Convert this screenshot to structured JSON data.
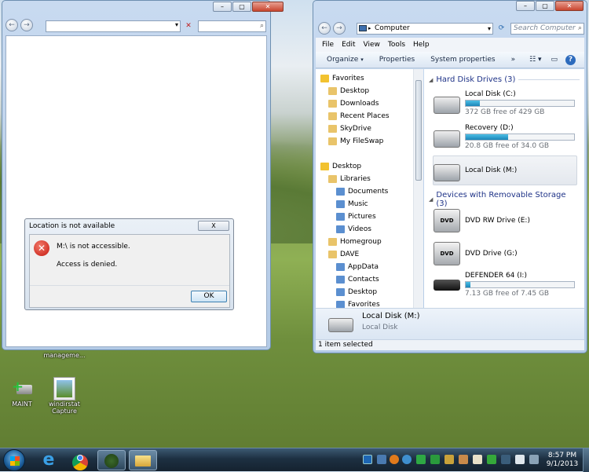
{
  "left_window": {
    "address": "",
    "search": ""
  },
  "dialog": {
    "title": "Location is not available",
    "close": "X",
    "message1": "M:\\ is not accessible.",
    "message2": "Access is denied.",
    "ok": "OK"
  },
  "explorer": {
    "breadcrumb": "Computer",
    "search_placeholder": "Search Computer",
    "menu": [
      "File",
      "Edit",
      "View",
      "Tools",
      "Help"
    ],
    "commands": [
      "Organize",
      "Properties",
      "System properties"
    ],
    "nav": [
      {
        "label": "Favorites",
        "indent": 0
      },
      {
        "label": "Desktop",
        "indent": 1
      },
      {
        "label": "Downloads",
        "indent": 1
      },
      {
        "label": "Recent Places",
        "indent": 1
      },
      {
        "label": "SkyDrive",
        "indent": 1
      },
      {
        "label": "My FileSwap",
        "indent": 1
      },
      {
        "label": "",
        "indent": 0
      },
      {
        "label": "Desktop",
        "indent": 0
      },
      {
        "label": "Libraries",
        "indent": 1
      },
      {
        "label": "Documents",
        "indent": 2
      },
      {
        "label": "Music",
        "indent": 2
      },
      {
        "label": "Pictures",
        "indent": 2
      },
      {
        "label": "Videos",
        "indent": 2
      },
      {
        "label": "Homegroup",
        "indent": 1
      },
      {
        "label": "DAVE",
        "indent": 1
      },
      {
        "label": "AppData",
        "indent": 2
      },
      {
        "label": "Contacts",
        "indent": 2
      },
      {
        "label": "Desktop",
        "indent": 2
      },
      {
        "label": "Favorites",
        "indent": 2
      }
    ],
    "group_hdd": "Hard Disk Drives (3)",
    "group_removable": "Devices with Removable Storage (3)",
    "drives": [
      {
        "name": "Local Disk (C:)",
        "free": "372 GB free of 429 GB",
        "used_fraction": 0.13
      },
      {
        "name": "Recovery (D:)",
        "free": "20.8 GB free of 34.0 GB",
        "used_fraction": 0.39
      },
      {
        "name": "Local Disk (M:)",
        "free": "",
        "used_fraction": null
      }
    ],
    "removable": [
      {
        "name": "DVD RW Drive (E:)",
        "free": ""
      },
      {
        "name": "DVD Drive (G:)",
        "free": ""
      },
      {
        "name": "DEFENDER 64 (I:)",
        "free": "7.13 GB free of 7.45 GB",
        "used_fraction": 0.04
      }
    ],
    "details_name": "Local Disk (M:)",
    "details_type": "Local Disk",
    "status": "1 item selected"
  },
  "desktop_icons": [
    {
      "label": "manageme..."
    },
    {
      "label": "MAINT"
    },
    {
      "label": "windirstat\nCapture"
    }
  ],
  "taskbar": {
    "time": "8:57 PM",
    "date": "9/1/2013"
  }
}
